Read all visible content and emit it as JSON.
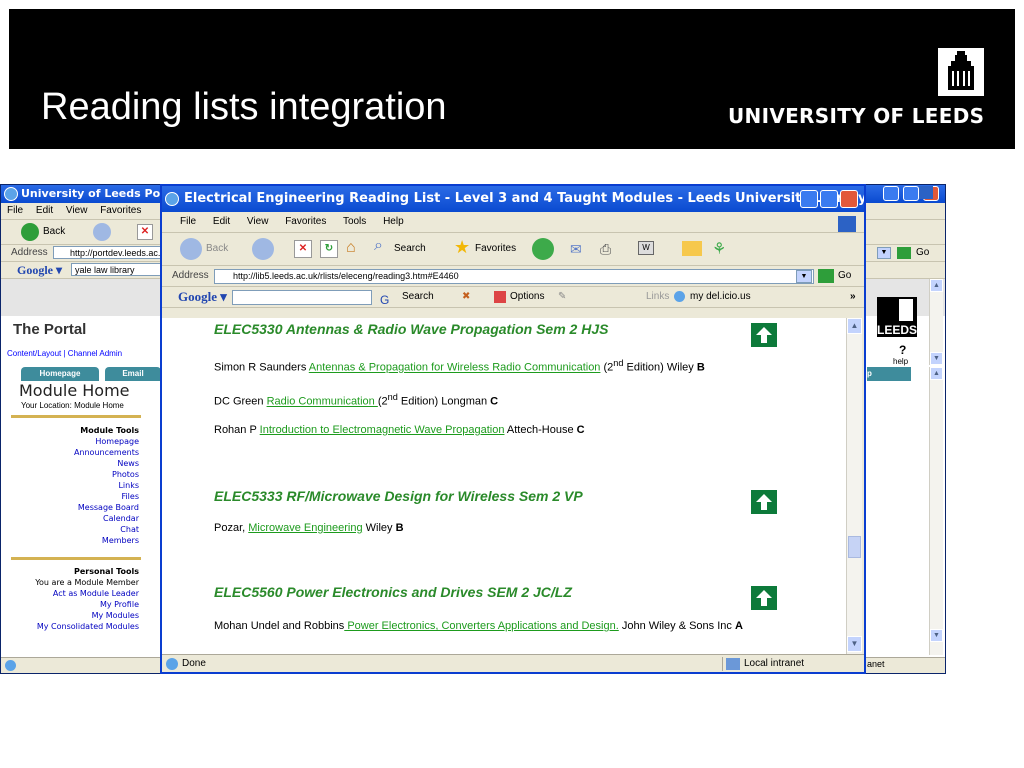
{
  "slide": {
    "title": "Reading lists integration",
    "logo_text": "UNIVERSITY OF LEEDS"
  },
  "back_window": {
    "title": "University of Leeds Portal",
    "menu": [
      "File",
      "Edit",
      "View",
      "Favorites"
    ],
    "back_label": "Back",
    "address_label": "Address",
    "address_value": "http://portdev.leeds.ac.uk",
    "google_search": "yale law library",
    "go_label": "Go",
    "portal_title": "The Portal",
    "portal_links": "Content/Layout | Channel Admin",
    "tabs": [
      "Homepage",
      "Email"
    ],
    "module_home": "Module Home",
    "your_location": "Your Location: Module Home",
    "leeds_fragment": "LEEDS",
    "help_label": "help",
    "tab_fragment": "p",
    "module_tools": {
      "heading": "Module Tools",
      "items": [
        "Homepage",
        "Announcements",
        "News",
        "Photos",
        "Links",
        "Files",
        "Message Board",
        "Calendar",
        "Chat",
        "Members"
      ]
    },
    "personal_tools": {
      "heading": "Personal Tools",
      "items": [
        "You are a Module Member",
        "Act as Module Leader",
        "My Profile",
        "My Modules",
        "My Consolidated Modules"
      ]
    },
    "status_right": "anet"
  },
  "front_window": {
    "title": "Electrical Engineering Reading List - Level 3 and 4 Taught Modules - Leeds University Library - Microsoft ...",
    "menu": [
      "File",
      "Edit",
      "View",
      "Favorites",
      "Tools",
      "Help"
    ],
    "toolbar": {
      "back": "Back",
      "search": "Search",
      "favorites": "Favorites"
    },
    "address_label": "Address",
    "address_value": "http://lib5.leeds.ac.uk/rlists/eleceng/reading3.htm#E4460",
    "go_label": "Go",
    "google": {
      "search_label": "Search",
      "options_label": "Options",
      "links_label": "Links",
      "delicious_label": "my del.icio.us"
    },
    "sections": [
      {
        "title": "ELEC5330 Antennas & Radio Wave Propagation Sem 2 HJS",
        "entries": [
          {
            "before": "Simon R Saunders ",
            "link": "Antennas & Propagation for Wireless Radio Communication",
            "after1": " (2",
            "sup": "nd",
            "after2": " Edition) Wiley ",
            "grade": "B"
          },
          {
            "before": "DC Green ",
            "link": "Radio Communication ",
            "after1": "(2",
            "sup": "nd",
            "after2": " Edition) Longman ",
            "grade": "C"
          },
          {
            "before": "Rohan P ",
            "link": "Introduction to Electromagnetic Wave Propagation",
            "after1": " Attech-House ",
            "sup": "",
            "after2": "",
            "grade": "C"
          }
        ]
      },
      {
        "title": "ELEC5333 RF/Microwave Design for Wireless Sem 2 VP",
        "entries": [
          {
            "before": "Pozar, ",
            "link": "Microwave Engineering",
            "after1": " Wiley ",
            "sup": "",
            "after2": "",
            "grade": "B"
          }
        ]
      },
      {
        "title": "ELEC5560 Power Electronics and Drives SEM 2 JC/LZ",
        "entries": [
          {
            "before": "Mohan Undel and Robbins",
            "link": " Power Electronics, Converters Applications and Design.",
            "after1": " John Wiley & Sons Inc ",
            "sup": "",
            "after2": "",
            "grade": "A"
          }
        ]
      }
    ],
    "status_left": "Done",
    "status_right": "Local intranet"
  },
  "colors": {
    "header_bg": "#000000",
    "xp_blue": "#0A4AD0",
    "section_green": "#2A8A2A",
    "link_green": "#1D9B1D",
    "up_button_green": "#0D7A3A",
    "module_tab_teal": "#3E8C9C"
  }
}
